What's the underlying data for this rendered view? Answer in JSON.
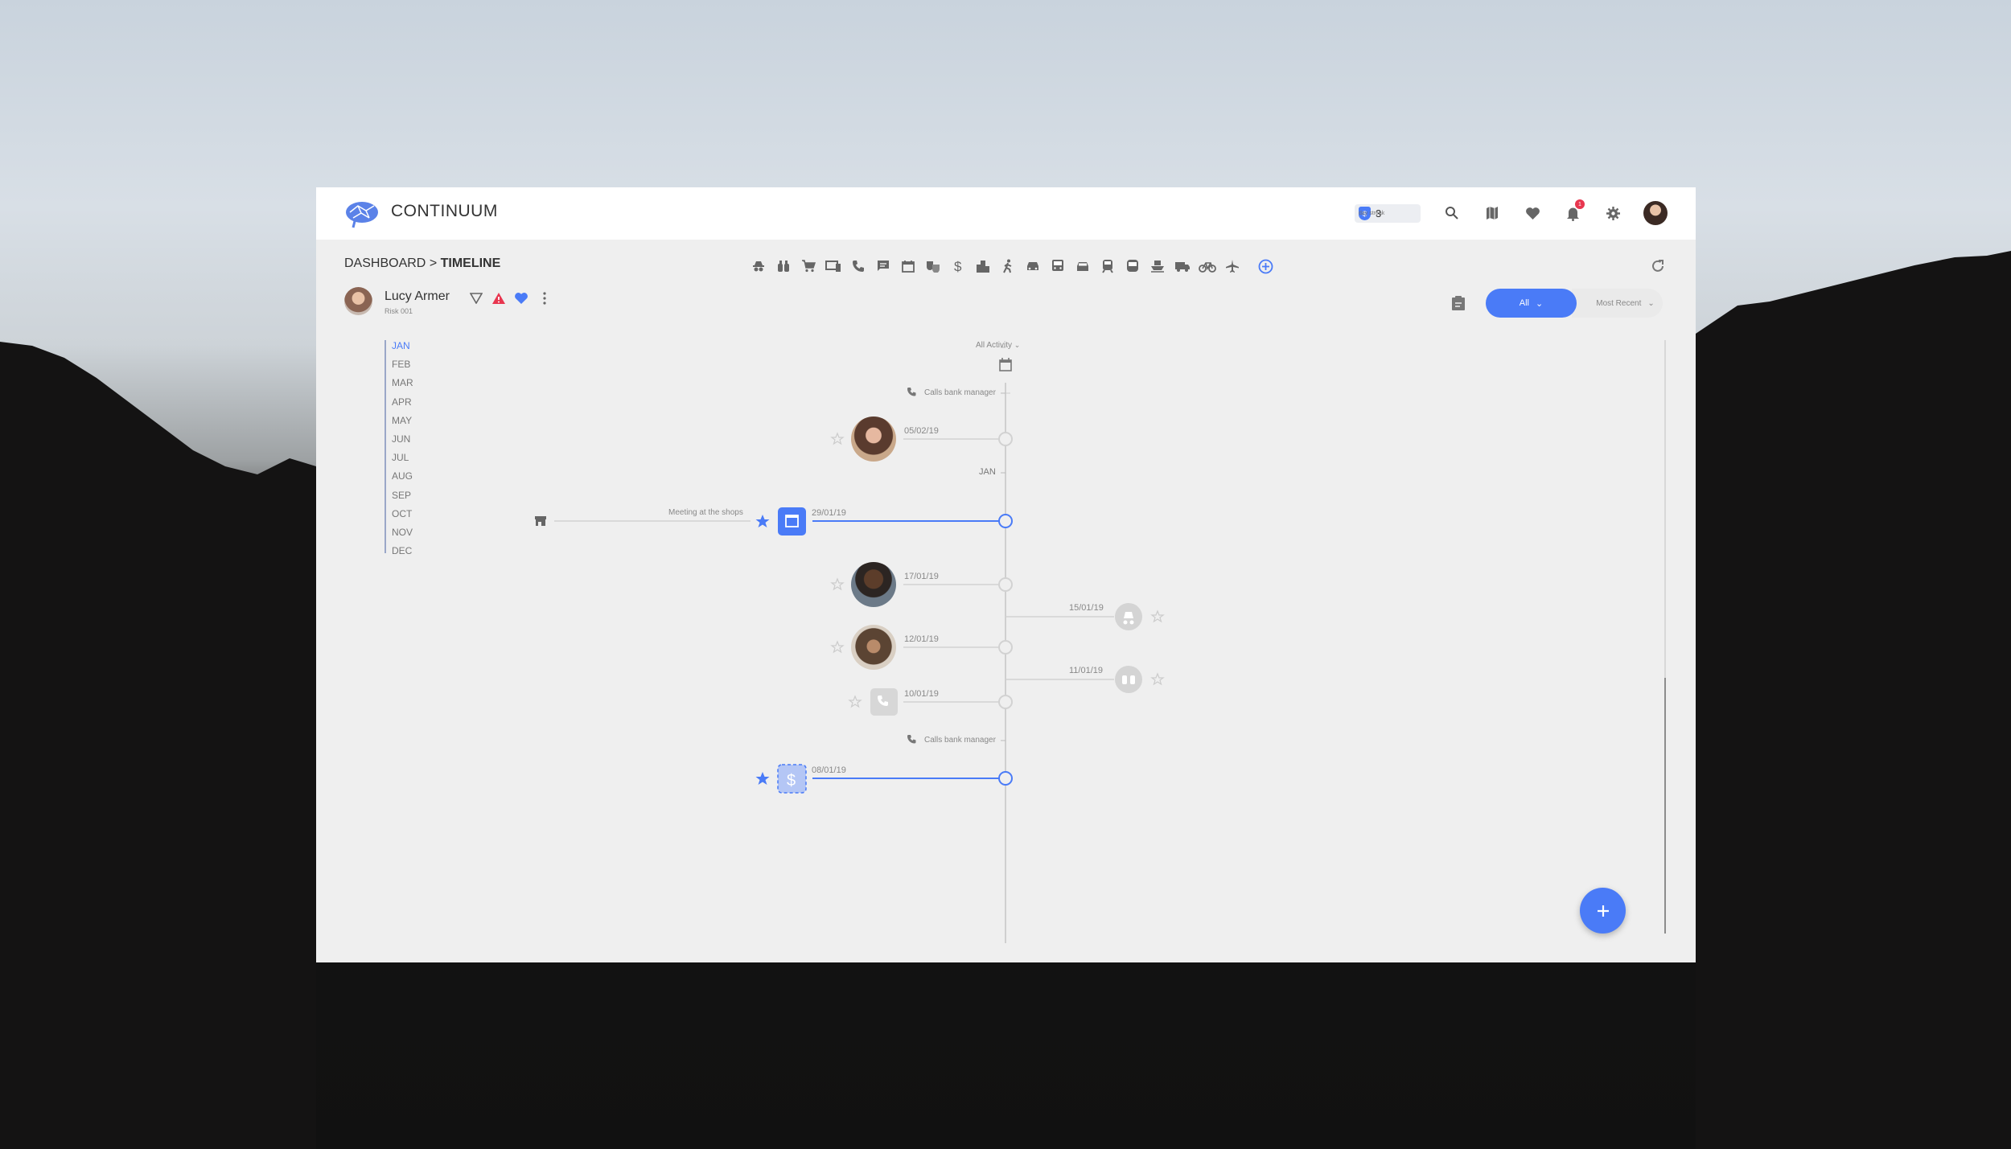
{
  "app": {
    "name": "CONTINUUM"
  },
  "header": {
    "streak_count": "3",
    "streak_label": "day streak",
    "notification_count": "1"
  },
  "breadcrumb": {
    "root": "DASHBOARD",
    "separator": ">",
    "current": "TIMELINE"
  },
  "person": {
    "name": "Lucy Armer",
    "risk": "Risk 001"
  },
  "categories": [
    "spy-icon",
    "binoculars-icon",
    "cart-icon",
    "devices-icon",
    "phone-icon",
    "message-icon",
    "calendar-icon",
    "masks-icon",
    "dollar-icon",
    "city-icon",
    "walk-icon",
    "car-icon",
    "bus-icon",
    "car-front-icon",
    "train-icon",
    "subway-icon",
    "boat-icon",
    "truck-icon",
    "bike-icon",
    "plane-icon",
    "add-circle-icon"
  ],
  "filters": {
    "type_selected": "All",
    "sort_selected": "Most Recent"
  },
  "months": [
    "JAN",
    "FEB",
    "MAR",
    "APR",
    "MAY",
    "JUN",
    "JUL",
    "AUG",
    "SEP",
    "OCT",
    "NOV",
    "DEC"
  ],
  "active_month": "JAN",
  "timeline": {
    "activity_filter": "All Activity",
    "section_label_top": "Calls bank manager",
    "section_label_bottom": "Calls bank manager",
    "month_divider": "JAN",
    "events": [
      {
        "date": "05/02/19",
        "kind": "person",
        "starred": false
      },
      {
        "date": "29/01/19",
        "kind": "calendar",
        "starred": true,
        "title": "Meeting at the shops"
      },
      {
        "date": "17/01/19",
        "kind": "person",
        "starred": false
      },
      {
        "date": "15/01/19",
        "kind": "spy",
        "starred": false
      },
      {
        "date": "12/01/19",
        "kind": "person",
        "starred": false
      },
      {
        "date": "11/01/19",
        "kind": "binoculars",
        "starred": false
      },
      {
        "date": "10/01/19",
        "kind": "phone",
        "starred": false
      },
      {
        "date": "08/01/19",
        "kind": "dollar",
        "starred": true
      }
    ]
  },
  "colors": {
    "accent": "#4a7bf7",
    "alert": "#e8364f",
    "muted": "#cccccc"
  }
}
